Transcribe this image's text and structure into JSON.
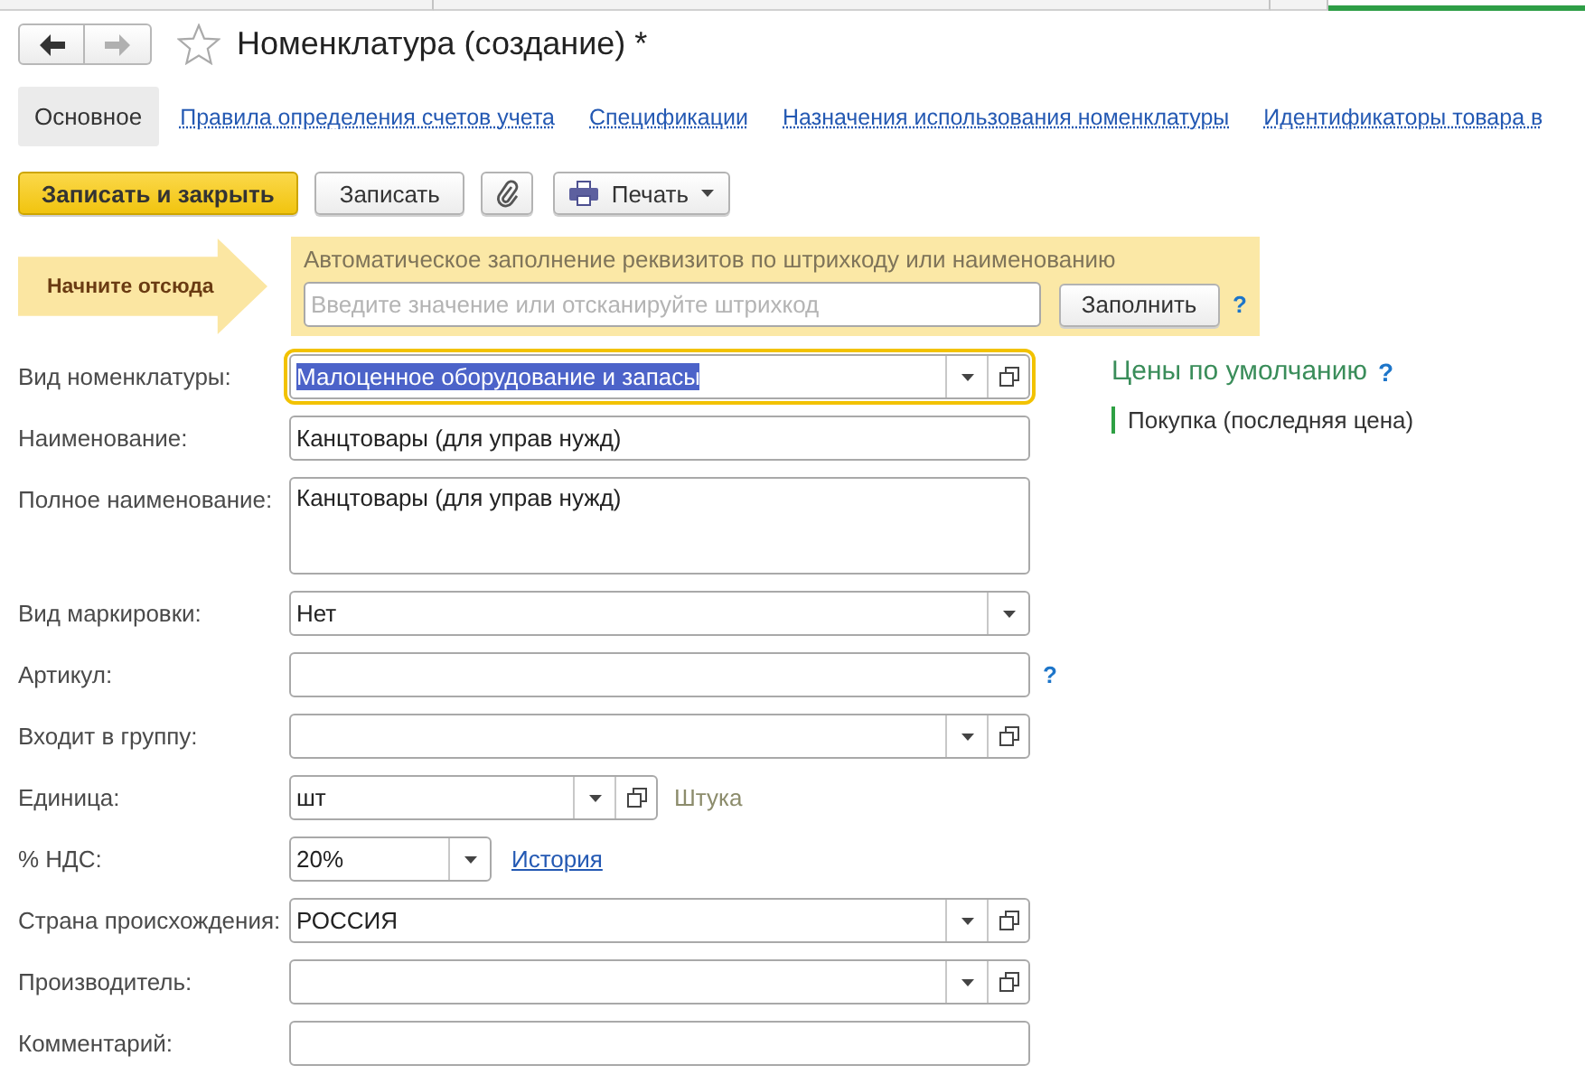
{
  "open_windows": [
    {
      "selected": false
    },
    {
      "selected": false
    },
    {
      "selected": false
    },
    {
      "selected": true
    }
  ],
  "nav_buttons": [
    {
      "kind": "back",
      "disabled": false
    },
    {
      "kind": "forward",
      "disabled": true
    }
  ],
  "favorite": {
    "starred": false
  },
  "window": {
    "title": "Номенклатура (создание) *"
  },
  "tabs": [
    {
      "label": "Основное",
      "selected": true
    },
    {
      "label": "Правила определения счетов учета",
      "selected": false
    },
    {
      "label": "Спецификации",
      "selected": false
    },
    {
      "label": "Назначения использования номенклатуры",
      "selected": false
    },
    {
      "label": "Идентификаторы товара в",
      "selected": false
    }
  ],
  "toolbar": [
    {
      "kind": "primary",
      "label": "Записать и закрыть"
    },
    {
      "kind": "default",
      "label": "Записать"
    },
    {
      "kind": "attach"
    },
    {
      "kind": "print_menu",
      "label": "Печать"
    }
  ],
  "start_hint": {
    "label": "Начните отсюда"
  },
  "autofill": {
    "title": "Автоматическое заполнение реквизитов по штрихкоду или наименованию",
    "placeholder": "Введите значение или отсканируйте штрихкод",
    "button": "Заполнить",
    "help": "?"
  },
  "fields": [
    {
      "kind": "reference",
      "label": "Вид номенклатуры:",
      "value": "Малоценное оборудование и запасы",
      "focused": true,
      "text_selected": true
    },
    {
      "kind": "input",
      "label": "Наименование:",
      "value": "Канцтовары (для управ нужд)",
      "focused": false,
      "text_selected": false
    },
    {
      "kind": "textarea",
      "label": "Полное наименование:",
      "value": "Канцтовары (для управ нужд)",
      "focused": false,
      "text_selected": false
    },
    {
      "kind": "select",
      "label": "Вид маркировки:",
      "value": "Нет",
      "focused": false,
      "text_selected": false
    },
    {
      "kind": "input",
      "label": "Артикул:",
      "help": "?",
      "focused": false
    },
    {
      "kind": "reference",
      "label": "Входит в группу:",
      "focused": false
    },
    {
      "kind": "reference",
      "label": "Единица:",
      "value": "шт",
      "note": "Штука",
      "focused": false,
      "text_selected": false
    },
    {
      "kind": "select",
      "label": "% НДС:",
      "value": "20%",
      "link": "История",
      "focused": false,
      "text_selected": false
    },
    {
      "kind": "reference",
      "label": "Страна происхождения:",
      "value": "РОССИЯ",
      "focused": false,
      "text_selected": false
    },
    {
      "kind": "reference",
      "label": "Производитель:",
      "focused": false
    },
    {
      "kind": "input",
      "label": "Комментарий:",
      "focused": false
    }
  ],
  "prices": {
    "title": "Цены по умолчанию",
    "help": "?",
    "items": [
      {
        "label": "Покупка (последняя цена)"
      }
    ]
  }
}
